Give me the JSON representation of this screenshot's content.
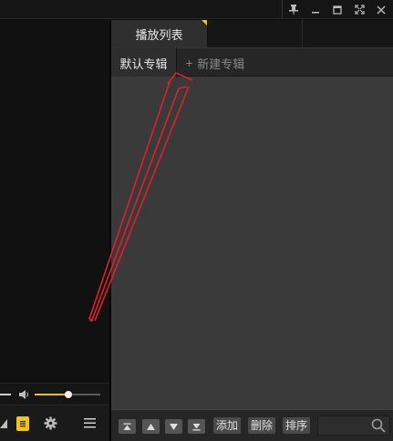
{
  "titlebar": {
    "buttons": [
      {
        "name": "pin-icon"
      },
      {
        "name": "minimize-icon"
      },
      {
        "name": "maximize-icon"
      },
      {
        "name": "fullscreen-icon"
      },
      {
        "name": "close-icon"
      }
    ]
  },
  "player": {
    "volume_level": 0.52,
    "accent_color": "#e8c12a",
    "controls": [
      "triangle-icon",
      "lyrics-icon",
      "gear-icon",
      "menu-icon"
    ]
  },
  "playlist": {
    "tabs": [
      {
        "label": "播放列表",
        "active": true
      }
    ],
    "albums": [
      {
        "label": "默认专辑",
        "active": true
      }
    ],
    "new_album_plus": "+",
    "new_album_label": "新建专辑",
    "bottom": {
      "move_buttons": [
        "move-top-icon",
        "move-up-icon",
        "move-down-icon",
        "move-bottom-icon"
      ],
      "add_label": "添加",
      "delete_label": "删除",
      "sort_label": "排序",
      "search_placeholder": ""
    }
  },
  "annotation": {
    "color": "#e0202a"
  }
}
